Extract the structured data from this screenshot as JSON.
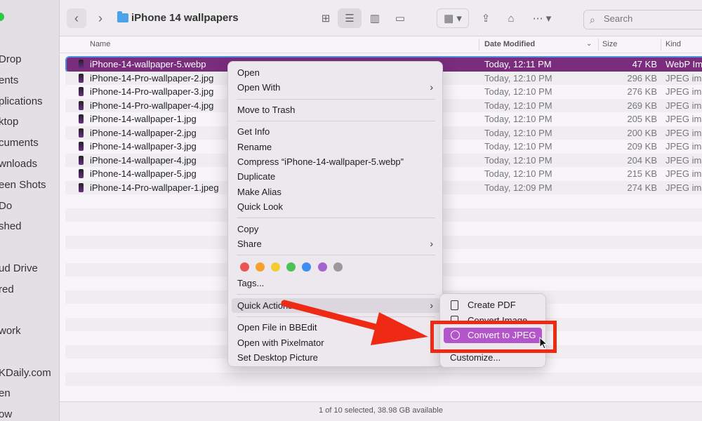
{
  "sidebar": {
    "items": [
      "Drop",
      "ents",
      "plications",
      "ktop",
      "cuments",
      "wnloads",
      "een Shots",
      "Do",
      "shed",
      "ud Drive",
      "red",
      "work",
      "KDaily.com",
      "en",
      "ow"
    ]
  },
  "toolbar": {
    "title": "iPhone 14 wallpapers",
    "search_placeholder": "Search"
  },
  "columns": {
    "name": "Name",
    "date": "Date Modified",
    "size": "Size",
    "kind": "Kind"
  },
  "files": [
    {
      "name": "iPhone-14-wallpaper-5.webp",
      "date": "Today, 12:11 PM",
      "size": "47 KB",
      "kind": "WebP Im"
    },
    {
      "name": "iPhone-14-Pro-wallpaper-2.jpg",
      "date": "Today, 12:10 PM",
      "size": "296 KB",
      "kind": "JPEG ima"
    },
    {
      "name": "iPhone-14-Pro-wallpaper-3.jpg",
      "date": "Today, 12:10 PM",
      "size": "276 KB",
      "kind": "JPEG ima"
    },
    {
      "name": "iPhone-14-Pro-wallpaper-4.jpg",
      "date": "Today, 12:10 PM",
      "size": "269 KB",
      "kind": "JPEG ima"
    },
    {
      "name": "iPhone-14-wallpaper-1.jpg",
      "date": "Today, 12:10 PM",
      "size": "205 KB",
      "kind": "JPEG ima"
    },
    {
      "name": "iPhone-14-wallpaper-2.jpg",
      "date": "Today, 12:10 PM",
      "size": "200 KB",
      "kind": "JPEG ima"
    },
    {
      "name": "iPhone-14-wallpaper-3.jpg",
      "date": "Today, 12:10 PM",
      "size": "209 KB",
      "kind": "JPEG ima"
    },
    {
      "name": "iPhone-14-wallpaper-4.jpg",
      "date": "Today, 12:10 PM",
      "size": "204 KB",
      "kind": "JPEG ima"
    },
    {
      "name": "iPhone-14-wallpaper-5.jpg",
      "date": "Today, 12:10 PM",
      "size": "215 KB",
      "kind": "JPEG ima"
    },
    {
      "name": "iPhone-14-Pro-wallpaper-1.jpeg",
      "date": "Today, 12:09 PM",
      "size": "274 KB",
      "kind": "JPEG ima"
    }
  ],
  "context_menu": {
    "open": "Open",
    "open_with": "Open With",
    "move_to_trash": "Move to Trash",
    "get_info": "Get Info",
    "rename": "Rename",
    "compress": "Compress “iPhone-14-wallpaper-5.webp”",
    "duplicate": "Duplicate",
    "make_alias": "Make Alias",
    "quick_look": "Quick Look",
    "copy": "Copy",
    "share": "Share",
    "tags": "Tags...",
    "quick_actions": "Quick Actions",
    "open_bbedit": "Open File in BBEdit",
    "open_pixelmator": "Open with Pixelmator",
    "set_desktop": "Set Desktop Picture",
    "tag_colors": [
      "#ec5353",
      "#f5a12b",
      "#f3cc2f",
      "#4cc255",
      "#3d8ef0",
      "#a463cf",
      "#9a9a9a"
    ]
  },
  "submenu": {
    "create_pdf": "Create PDF",
    "convert_image": "Convert Image",
    "convert_jpeg": "Convert to JPEG",
    "customize": "Customize..."
  },
  "status_bar": "1 of 10 selected, 38.98 GB available",
  "colors": {
    "selection": "#7a2c7d",
    "highlight": "#b356c9",
    "annotation": "#ee2a15"
  }
}
